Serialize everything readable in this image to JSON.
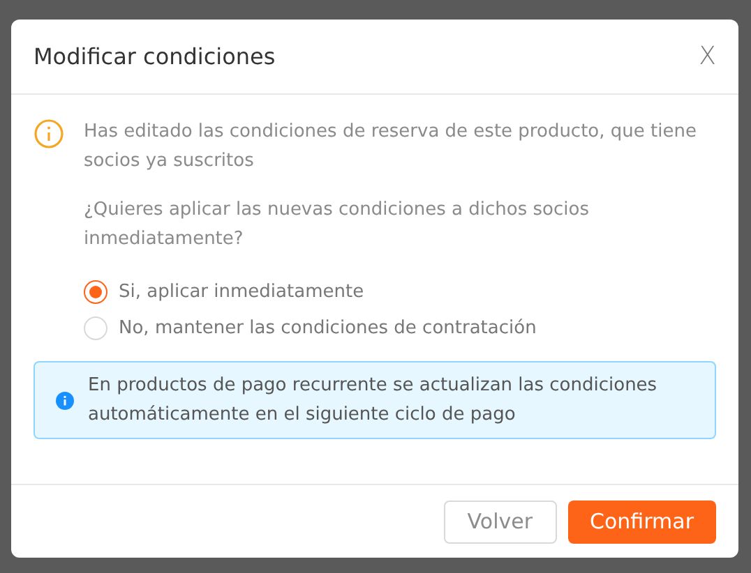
{
  "dialog": {
    "title": "Modificar condiciones",
    "close": "X",
    "warning": "Has editado las condiciones de reserva de este producto, que tiene socios ya suscritos",
    "question": "¿Quieres aplicar las nuevas condiciones a dichos socios inmediatamente?",
    "options": [
      {
        "label": "Si, aplicar inmediatamente",
        "selected": true
      },
      {
        "label": "No, mantener las condiciones de contratación",
        "selected": false
      }
    ],
    "info": "En productos de pago recurrente se actualizan las condiciones automáticamente en el siguiente ciclo de pago",
    "buttons": [
      {
        "label": "Volver",
        "kind": "secondary"
      },
      {
        "label": "Confirmar",
        "kind": "primary"
      }
    ]
  }
}
